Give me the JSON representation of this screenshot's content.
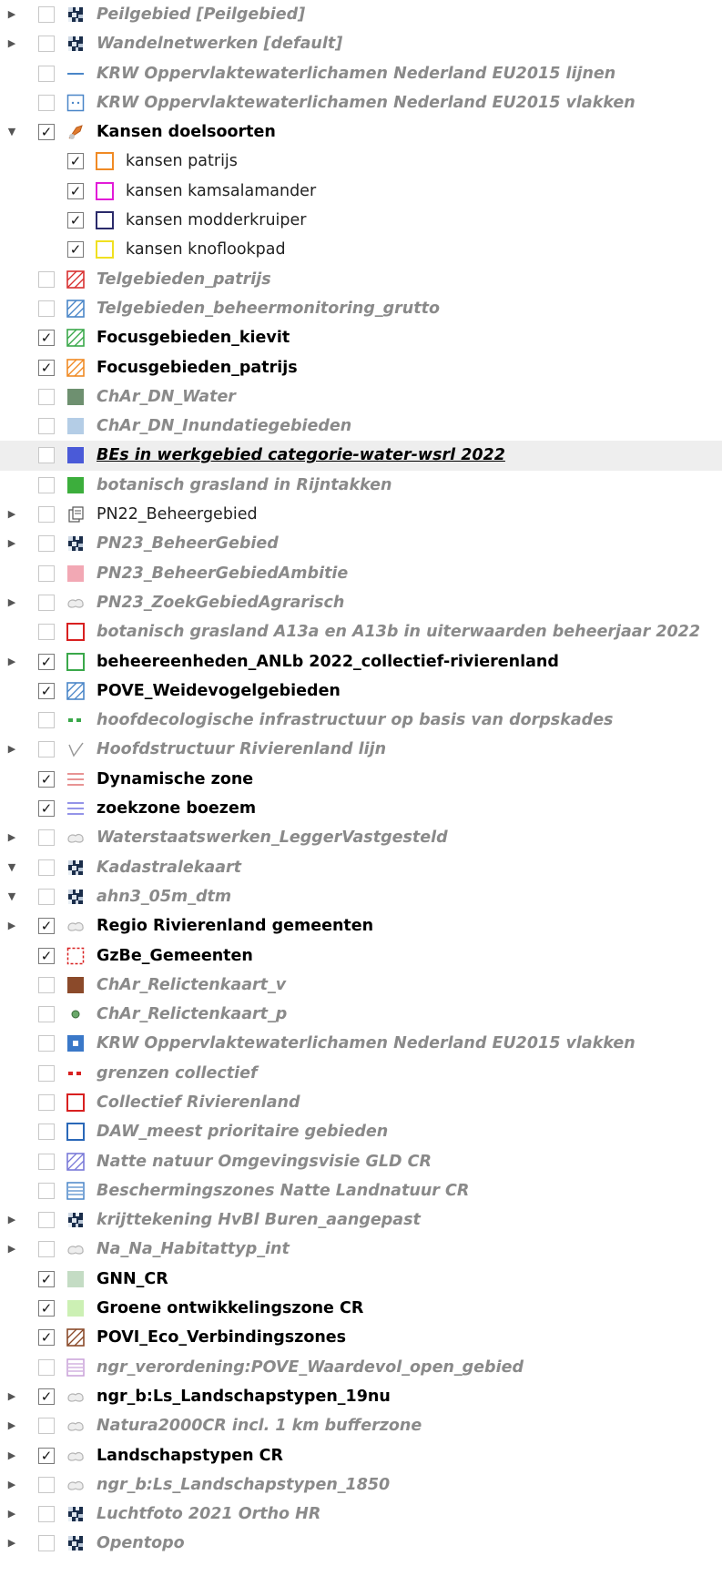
{
  "layers": [
    {
      "label": "Peilgebied [Peilgebied]",
      "checked": false,
      "expander": "collapsed",
      "indent": 0,
      "style": "muted",
      "symbol": "raster-icon"
    },
    {
      "label": "Wandelnetwerken [default]",
      "checked": false,
      "expander": "collapsed",
      "indent": 0,
      "style": "muted",
      "symbol": "raster-icon"
    },
    {
      "label": "KRW Oppervlaktewaterlichamen Nederland EU2015 lijnen",
      "checked": false,
      "expander": "none",
      "indent": 0,
      "style": "muted",
      "symbol": "line-icon",
      "color": "#4a86c8"
    },
    {
      "label": "KRW Oppervlaktewaterlichamen Nederland EU2015 vlakken",
      "checked": false,
      "expander": "none",
      "indent": 0,
      "style": "muted",
      "symbol": "dotted-square-icon",
      "color": "#4a86c8"
    },
    {
      "label": "Kansen doelsoorten",
      "checked": true,
      "expander": "expanded",
      "indent": 0,
      "style": "on",
      "symbol": "group-icon",
      "color": "#e07b2e"
    },
    {
      "label": "kansen patrijs",
      "checked": true,
      "expander": "none",
      "indent": 1,
      "style": "plain",
      "symbol": "outline-square-icon",
      "color": "#f08a24"
    },
    {
      "label": "kansen kamsalamander",
      "checked": true,
      "expander": "none",
      "indent": 1,
      "style": "plain",
      "symbol": "outline-square-icon",
      "color": "#e21bd8"
    },
    {
      "label": "kansen modderkruiper",
      "checked": true,
      "expander": "none",
      "indent": 1,
      "style": "plain",
      "symbol": "outline-square-icon",
      "color": "#2a2a6a"
    },
    {
      "label": "kansen knoflookpad",
      "checked": true,
      "expander": "none",
      "indent": 1,
      "style": "plain",
      "symbol": "outline-square-icon",
      "color": "#f0e020"
    },
    {
      "label": "Telgebieden_patrijs",
      "checked": false,
      "expander": "none",
      "indent": 0,
      "style": "muted",
      "symbol": "hatched-square-icon",
      "color": "#d83030"
    },
    {
      "label": "Telgebieden_beheermonitoring_grutto",
      "checked": false,
      "expander": "none",
      "indent": 0,
      "style": "muted",
      "symbol": "hatched-square-icon",
      "color": "#4a86c8"
    },
    {
      "label": "Focusgebieden_kievit",
      "checked": true,
      "expander": "none",
      "indent": 0,
      "style": "on",
      "symbol": "hatched-square-icon",
      "color": "#3aa84a"
    },
    {
      "label": "Focusgebieden_patrijs",
      "checked": true,
      "expander": "none",
      "indent": 0,
      "style": "on",
      "symbol": "hatched-square-icon",
      "color": "#f08a24"
    },
    {
      "label": "ChAr_DN_Water",
      "checked": false,
      "expander": "none",
      "indent": 0,
      "style": "muted",
      "symbol": "filled-square-icon",
      "color": "#6e9070"
    },
    {
      "label": "ChAr_DN_Inundatiegebieden",
      "checked": false,
      "expander": "none",
      "indent": 0,
      "style": "muted",
      "symbol": "filled-square-icon",
      "color": "#b4cde6"
    },
    {
      "label": "BEs in werkgebied categorie-water-wsrl 2022",
      "checked": false,
      "expander": "none",
      "indent": 0,
      "style": "muted-under",
      "symbol": "filled-square-icon",
      "color": "#4a5ad8",
      "selected": true
    },
    {
      "label": "botanisch grasland in Rijntakken",
      "checked": false,
      "expander": "none",
      "indent": 0,
      "style": "muted",
      "symbol": "filled-square-icon",
      "color": "#3cae3c"
    },
    {
      "label": "PN22_Beheergebied",
      "checked": false,
      "expander": "collapsed",
      "indent": 0,
      "style": "plain",
      "symbol": "copy-icon"
    },
    {
      "label": "PN23_BeheerGebied",
      "checked": false,
      "expander": "collapsed",
      "indent": 0,
      "style": "muted",
      "symbol": "raster-icon"
    },
    {
      "label": "PN23_BeheerGebiedAmbitie",
      "checked": false,
      "expander": "none",
      "indent": 0,
      "style": "muted",
      "symbol": "filled-square-icon",
      "color": "#f2a8b4"
    },
    {
      "label": "PN23_ZoekGebiedAgrarisch",
      "checked": false,
      "expander": "collapsed",
      "indent": 0,
      "style": "muted",
      "symbol": "cloud-icon"
    },
    {
      "label": "botanisch grasland A13a en A13b in uiterwaarden beheerjaar 2022",
      "checked": false,
      "expander": "none",
      "indent": 0,
      "style": "muted",
      "symbol": "outline-square-icon",
      "color": "#d82020"
    },
    {
      "label": "beheereenheden_ANLb 2022_collectief-rivierenland",
      "checked": true,
      "expander": "collapsed",
      "indent": 0,
      "style": "on",
      "symbol": "outline-square-icon",
      "color": "#3aa84a"
    },
    {
      "label": "POVE_Weidevogelgebieden",
      "checked": true,
      "expander": "none",
      "indent": 0,
      "style": "on",
      "symbol": "hatched-square-icon",
      "color": "#4a86c8"
    },
    {
      "label": "hoofdecologische infrastructuur op basis van dorpskades",
      "checked": false,
      "expander": "none",
      "indent": 0,
      "style": "muted",
      "symbol": "dash-icon",
      "color": "#3aa84a"
    },
    {
      "label": "Hoofdstructuur Rivierenland lijn",
      "checked": false,
      "expander": "collapsed",
      "indent": 0,
      "style": "muted",
      "symbol": "check-line-icon",
      "color": "#999999"
    },
    {
      "label": "Dynamische zone",
      "checked": true,
      "expander": "none",
      "indent": 0,
      "style": "on",
      "symbol": "striped-lines-icon",
      "color": "#e07070"
    },
    {
      "label": "zoekzone boezem",
      "checked": true,
      "expander": "none",
      "indent": 0,
      "style": "on",
      "symbol": "striped-lines-icon",
      "color": "#7070e0"
    },
    {
      "label": "Waterstaatswerken_LeggerVastgesteld",
      "checked": false,
      "expander": "collapsed",
      "indent": 0,
      "style": "muted",
      "symbol": "cloud-icon"
    },
    {
      "label": "Kadastralekaart",
      "checked": false,
      "expander": "expanded",
      "indent": 0,
      "style": "muted",
      "symbol": "raster-icon"
    },
    {
      "label": "ahn3_05m_dtm",
      "checked": false,
      "expander": "expanded",
      "indent": 0,
      "style": "muted",
      "symbol": "raster-icon"
    },
    {
      "label": "Regio Rivierenland gemeenten",
      "checked": true,
      "expander": "collapsed",
      "indent": 0,
      "style": "on",
      "symbol": "cloud-icon"
    },
    {
      "label": "GzBe_Gemeenten",
      "checked": true,
      "expander": "none",
      "indent": 0,
      "style": "on",
      "symbol": "dashed-square-icon",
      "color": "#d82020"
    },
    {
      "label": "ChAr_Relictenkaart_v",
      "checked": false,
      "expander": "none",
      "indent": 0,
      "style": "muted",
      "symbol": "filled-square-icon",
      "color": "#8b4a2a"
    },
    {
      "label": "ChAr_Relictenkaart_p",
      "checked": false,
      "expander": "none",
      "indent": 0,
      "style": "muted",
      "symbol": "point-icon",
      "color": "#6aa86a"
    },
    {
      "label": "KRW Oppervlaktewaterlichamen Nederland EU2015 vlakken",
      "checked": false,
      "expander": "none",
      "indent": 0,
      "style": "muted",
      "symbol": "filled-dot-square-icon",
      "color": "#3a78c8"
    },
    {
      "label": "grenzen collectief",
      "checked": false,
      "expander": "none",
      "indent": 0,
      "style": "muted",
      "symbol": "dash-icon",
      "color": "#d82020"
    },
    {
      "label": "Collectief Rivierenland",
      "checked": false,
      "expander": "none",
      "indent": 0,
      "style": "muted",
      "symbol": "outline-square-icon",
      "color": "#d82020"
    },
    {
      "label": "DAW_meest prioritaire gebieden",
      "checked": false,
      "expander": "none",
      "indent": 0,
      "style": "muted",
      "symbol": "outline-square-icon",
      "color": "#2a68b8"
    },
    {
      "label": "Natte natuur Omgevingsvisie GLD CR",
      "checked": false,
      "expander": "none",
      "indent": 0,
      "style": "muted",
      "symbol": "hatched-square-icon",
      "color": "#7a7ad8"
    },
    {
      "label": "Beschermingszones Natte Landnatuur CR",
      "checked": false,
      "expander": "none",
      "indent": 0,
      "style": "muted",
      "symbol": "striped-square-icon",
      "color": "#4a86c8"
    },
    {
      "label": "krijttekening HvBl Buren_aangepast",
      "checked": false,
      "expander": "collapsed",
      "indent": 0,
      "style": "muted",
      "symbol": "raster-icon"
    },
    {
      "label": "Na_Na_Habitattyp_int",
      "checked": false,
      "expander": "collapsed",
      "indent": 0,
      "style": "muted",
      "symbol": "cloud-icon"
    },
    {
      "label": "GNN_CR",
      "checked": true,
      "expander": "none",
      "indent": 0,
      "style": "on",
      "symbol": "filled-square-icon",
      "color": "#c4dcc4"
    },
    {
      "label": "Groene ontwikkelingszone CR",
      "checked": true,
      "expander": "none",
      "indent": 0,
      "style": "on",
      "symbol": "filled-square-icon",
      "color": "#ccf0b4"
    },
    {
      "label": "POVI_Eco_Verbindingszones",
      "checked": true,
      "expander": "none",
      "indent": 0,
      "style": "on",
      "symbol": "hatched-square-icon",
      "color": "#8a4a2a"
    },
    {
      "label": "ngr_verordening:POVE_Waardevol_open_gebied",
      "checked": false,
      "expander": "none",
      "indent": 0,
      "style": "muted",
      "symbol": "striped-square-icon",
      "color": "#c8a0d8"
    },
    {
      "label": "ngr_b:Ls_Landschapstypen_19nu",
      "checked": true,
      "expander": "collapsed",
      "indent": 0,
      "style": "on",
      "symbol": "cloud-icon"
    },
    {
      "label": "Natura2000CR incl. 1 km bufferzone",
      "checked": false,
      "expander": "collapsed",
      "indent": 0,
      "style": "muted",
      "symbol": "cloud-icon"
    },
    {
      "label": "Landschapstypen CR",
      "checked": true,
      "expander": "collapsed",
      "indent": 0,
      "style": "on",
      "symbol": "cloud-icon"
    },
    {
      "label": "ngr_b:Ls_Landschapstypen_1850",
      "checked": false,
      "expander": "collapsed",
      "indent": 0,
      "style": "muted",
      "symbol": "cloud-icon"
    },
    {
      "label": "Luchtfoto 2021 Ortho HR",
      "checked": false,
      "expander": "collapsed",
      "indent": 0,
      "style": "muted",
      "symbol": "raster-icon"
    },
    {
      "label": "Opentopo",
      "checked": false,
      "expander": "collapsed",
      "indent": 0,
      "style": "muted",
      "symbol": "raster-icon"
    }
  ]
}
